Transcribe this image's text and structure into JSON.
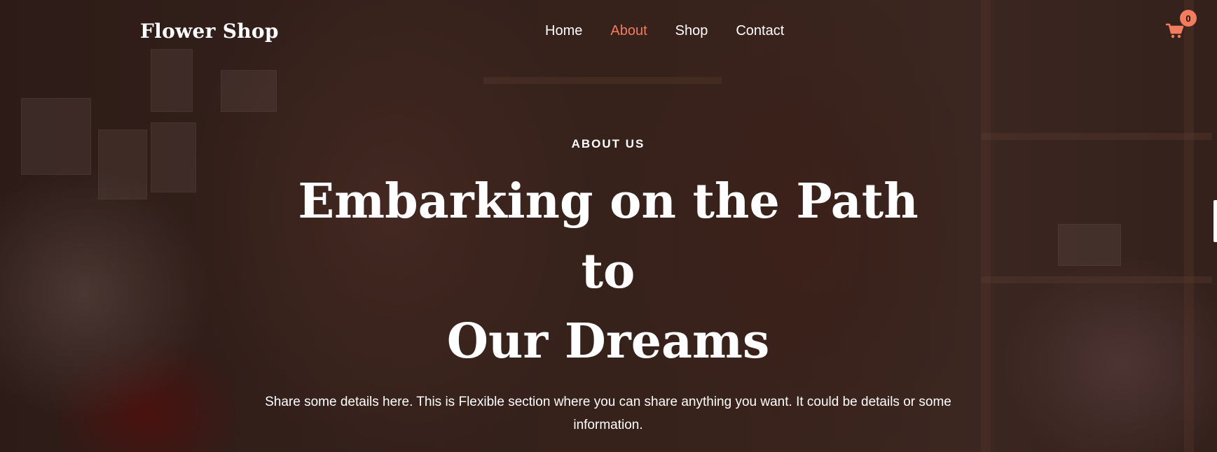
{
  "header": {
    "logo": "Flower Shop",
    "nav": [
      {
        "label": "Home",
        "active": false
      },
      {
        "label": "About",
        "active": true
      },
      {
        "label": "Shop",
        "active": false
      },
      {
        "label": "Contact",
        "active": false
      }
    ],
    "cart": {
      "icon": "cart-icon",
      "count": "0"
    }
  },
  "hero": {
    "eyebrow": "ABOUT US",
    "title_line1": "Embarking on the Path to",
    "title_line2": "Our Dreams",
    "description": "Share some details here. This is Flexible section where you can share anything you want. It could be details or some information."
  },
  "colors": {
    "accent": "#f27c5e",
    "text": "#ffffff",
    "overlay": "#230c08"
  }
}
